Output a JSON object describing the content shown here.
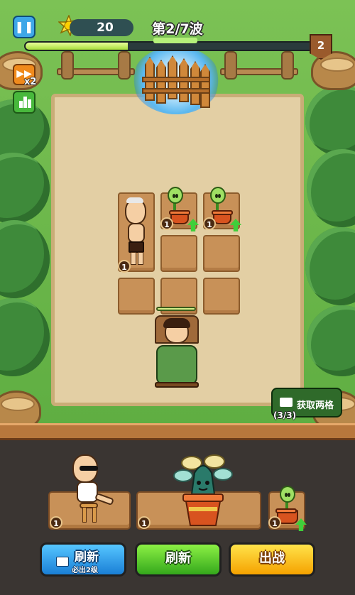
{
  "hud": {
    "sun_count": "20",
    "wave_text": "第2/7波",
    "wave_progress": 0.35,
    "level": "2",
    "speed_label": "x2"
  },
  "get_grid": {
    "label": "获取两格",
    "count": "(3/3)"
  },
  "board": {
    "cell_levels": [
      "1",
      "1",
      "1"
    ]
  },
  "bench": {
    "levels": [
      "1",
      "1",
      "1"
    ]
  },
  "buttons": {
    "ad_refresh_label": "刷新",
    "ad_refresh_sub": "必出2级",
    "refresh_label": "刷新",
    "fight_label": "出战"
  },
  "colors": {
    "grass": "#6cba4b",
    "dirt": "#e3cfa4",
    "accent_green": "#3fcf3a",
    "button_blue": "#2a9ae8",
    "button_yellow": "#ffc51a"
  },
  "icons": [
    "pause-icon",
    "sun-icon",
    "fast-forward-icon",
    "stats-icon",
    "video-icon",
    "upgrade-arrow-icon"
  ]
}
